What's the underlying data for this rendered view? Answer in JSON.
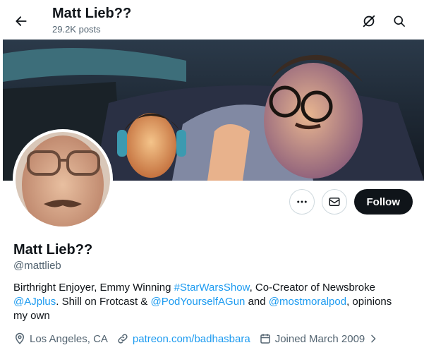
{
  "header": {
    "title": "Matt Lieb??",
    "post_count": "29.2K posts",
    "icons": {
      "back": "arrow-left-icon",
      "grok": "grok-icon",
      "search": "search-icon"
    }
  },
  "banner": {
    "description_icon": "banner-image"
  },
  "profile": {
    "display_name": "Matt Lieb??",
    "handle": "@mattlieb",
    "follow_label": "Follow",
    "more_icon": "more-icon",
    "message_icon": "mail-icon"
  },
  "bio": {
    "p1": "Birthright Enjoyer, Emmy Winning ",
    "hashtag": "#StarWarsShow",
    "p2": ", Co-Creator of Newsbroke ",
    "mention1": "@AJplus",
    "p3": ". Shill on Frotcast & ",
    "mention2": "@PodYourselfAGun",
    "p4": " and ",
    "mention3": "@mostmoralpod",
    "p5": ", opinions my own"
  },
  "meta": {
    "location": "Los Angeles, CA",
    "website": "patreon.com/badhasbara",
    "joined": "Joined March 2009"
  },
  "colors": {
    "accent": "#1d9bf0",
    "text": "#0f1419",
    "secondary": "#536471",
    "follow_bg": "#0f1419"
  }
}
